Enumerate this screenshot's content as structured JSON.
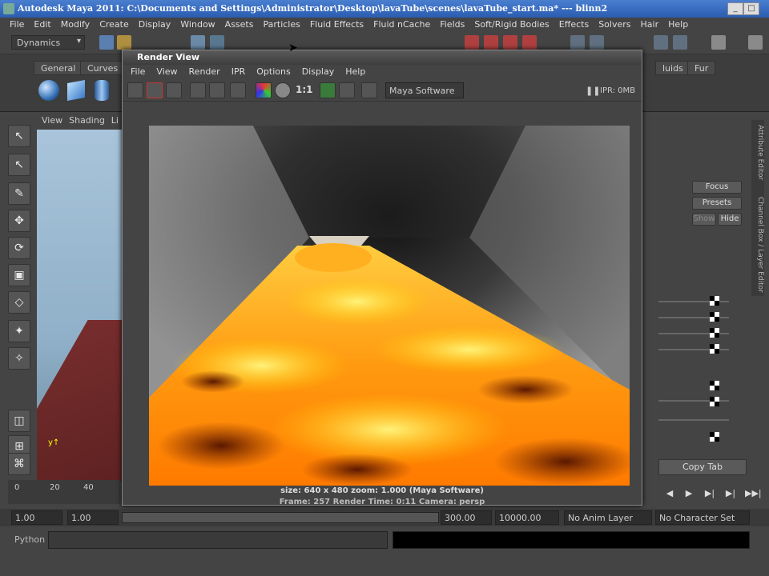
{
  "app": {
    "title": "Autodesk Maya 2011: C:\\Documents and Settings\\Administrator\\Desktop\\lavaTube\\scenes\\lavaTube_start.ma* --- blinn2"
  },
  "menu": [
    "File",
    "Edit",
    "Modify",
    "Create",
    "Display",
    "Window",
    "Assets",
    "Particles",
    "Fluid Effects",
    "Fluid nCache",
    "Fields",
    "Soft/Rigid Bodies",
    "Effects",
    "Solvers",
    "Hair",
    "Help"
  ],
  "status": {
    "menu_set": "Dynamics"
  },
  "shelf": {
    "tabs": [
      "General",
      "Curves"
    ],
    "right_tabs": [
      "luids",
      "Fur"
    ]
  },
  "viewport": {
    "menu": [
      "View",
      "Shading",
      "Li"
    ]
  },
  "timeline": {
    "ticks": [
      "0",
      "20",
      "40"
    ]
  },
  "range": {
    "start": "1.00",
    "start2": "1.00",
    "end": "300.00",
    "end2": "10000.00",
    "anim_layer": "No Anim Layer",
    "char_set": "No Character Set"
  },
  "command": {
    "label": "Python"
  },
  "right_panel": {
    "tab_attr": "Attribute Editor",
    "tab_channel": "Channel Box / Layer Editor",
    "focus": "Focus",
    "presets": "Presets",
    "show": "Show",
    "hide": "Hide",
    "copy_tab": "Copy Tab"
  },
  "render_view": {
    "title": "Render View",
    "menu": [
      "File",
      "View",
      "Render",
      "IPR",
      "Options",
      "Display",
      "Help"
    ],
    "renderer": "Maya Software",
    "ipr": "IPR: 0MB",
    "ratio": "1:1",
    "caption": "size: 640 x 480 zoom: 1.000        (Maya Software)",
    "caption2": "Frame: 257        Render Time: 0:11        Camera: persp"
  },
  "colors": {
    "lava_bright": "#ffd000",
    "lava_mid": "#ff7a00",
    "lava_dark": "#5a1800",
    "tube_gray": "#7a7a7a"
  }
}
